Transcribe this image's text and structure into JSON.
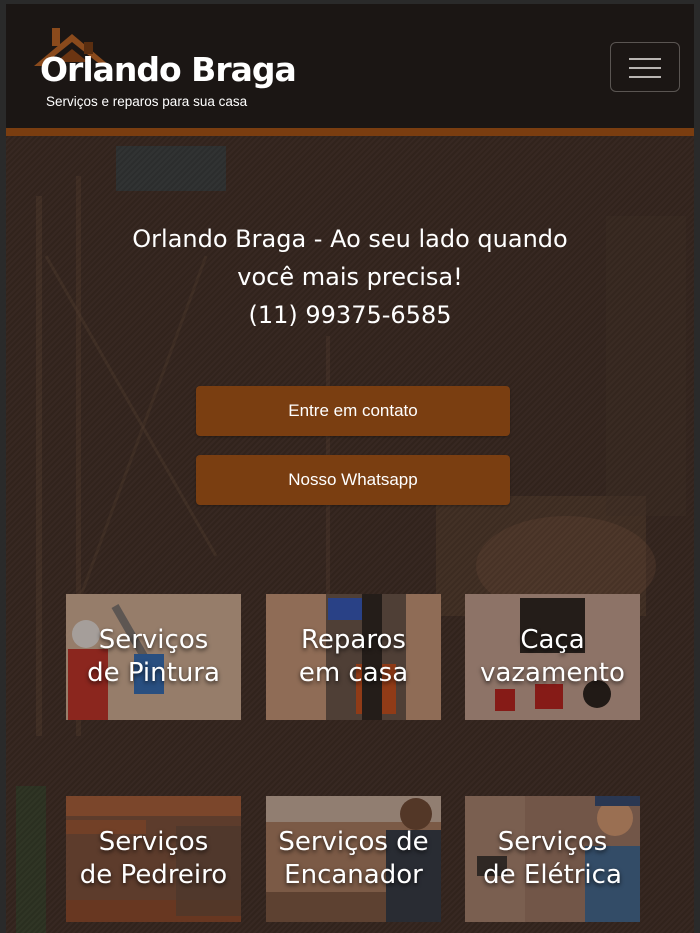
{
  "header": {
    "brand_name": "Orlando Braga",
    "tagline": "Serviços e reparos para sua casa",
    "menu_icon": "hamburger-menu-icon"
  },
  "hero": {
    "headline_line1": "Orlando Braga - Ao seu lado quando",
    "headline_line2": "você mais precisa!",
    "phone": "(11) 99375-6585",
    "contact_button_label": "Entre em contato",
    "whatsapp_button_label": "Nosso Whatsapp"
  },
  "services": [
    {
      "label": "Serviços\nde Pintura"
    },
    {
      "label": "Reparos\nem casa"
    },
    {
      "label": "Caça\nvazamento"
    },
    {
      "label": "Serviços\nde Pedreiro"
    },
    {
      "label": "Serviços de\nEncanador"
    },
    {
      "label": "Serviços\nde Elétrica"
    }
  ],
  "colors": {
    "accent": "#7a3e11",
    "navbar": "#1b1614",
    "accent_stripe": "#7a3d10",
    "text": "#ffffff"
  }
}
